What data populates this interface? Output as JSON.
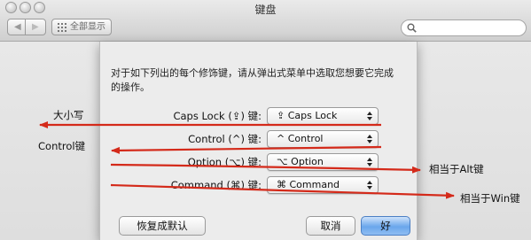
{
  "window": {
    "title": "键盘",
    "show_all_label": "全部显示"
  },
  "sheet": {
    "instruction": "对于如下列出的每个修饰键，请从弹出式菜单中选取您想要它完成的操作。",
    "rows": [
      {
        "label": "Caps Lock (⇪) 键:",
        "value": "⇪ Caps Lock"
      },
      {
        "label": "Control (^) 键:",
        "value": "^ Control"
      },
      {
        "label": "Option (⌥) 键:",
        "value": "⌥ Option"
      },
      {
        "label": "Command (⌘) 键:",
        "value": "⌘ Command"
      }
    ],
    "restore_label": "恢复成默认",
    "cancel_label": "取消",
    "ok_label": "好"
  },
  "annotations": {
    "caps_lock_note": "大小写",
    "control_note": "Control键",
    "option_note": "相当于Alt键",
    "command_note": "相当于Win键",
    "color": "#d42a1a"
  }
}
